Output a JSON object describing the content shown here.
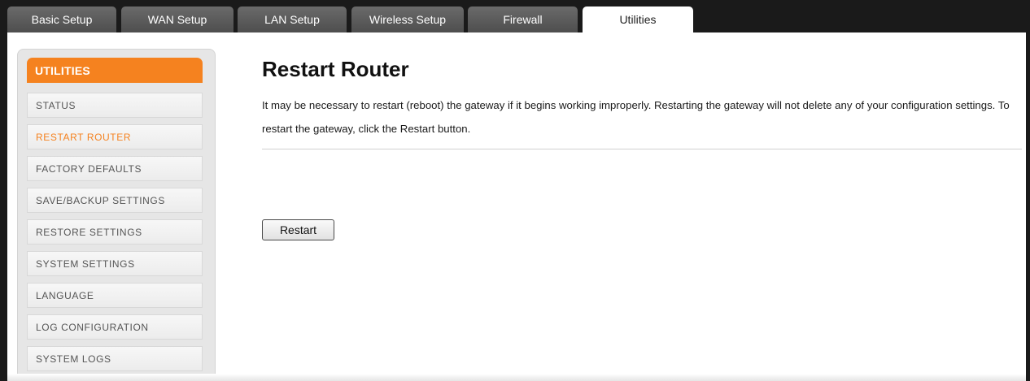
{
  "tabs": [
    {
      "label": "Basic Setup",
      "active": false
    },
    {
      "label": "WAN Setup",
      "active": false
    },
    {
      "label": "LAN Setup",
      "active": false
    },
    {
      "label": "Wireless Setup",
      "active": false
    },
    {
      "label": "Firewall",
      "active": false
    },
    {
      "label": "Utilities",
      "active": true
    }
  ],
  "sidebar": {
    "header": "UTILITIES",
    "items": [
      {
        "label": "STATUS",
        "active": false
      },
      {
        "label": "RESTART ROUTER",
        "active": true
      },
      {
        "label": "FACTORY DEFAULTS",
        "active": false
      },
      {
        "label": "SAVE/BACKUP SETTINGS",
        "active": false
      },
      {
        "label": "RESTORE SETTINGS",
        "active": false
      },
      {
        "label": "SYSTEM SETTINGS",
        "active": false
      },
      {
        "label": "LANGUAGE",
        "active": false
      },
      {
        "label": "LOG CONFIGURATION",
        "active": false
      },
      {
        "label": "SYSTEM LOGS",
        "active": false
      }
    ]
  },
  "main": {
    "title": "Restart Router",
    "description": "It may be necessary to restart (reboot) the gateway if it begins working improperly. Restarting the gateway will not delete any of your configuration settings. To restart the gateway, click the Restart button.",
    "restart_button_label": "Restart"
  },
  "colors": {
    "accent": "#f5821f",
    "tab_bar": "#1a1a1a"
  }
}
